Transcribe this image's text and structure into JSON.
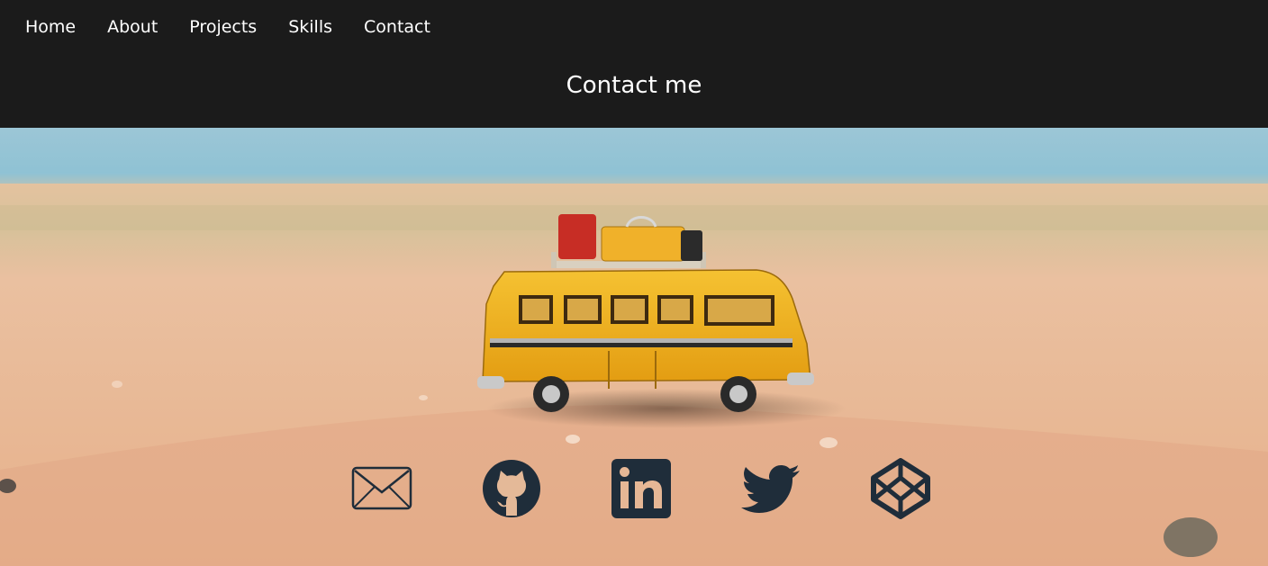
{
  "nav": {
    "items": [
      {
        "label": "Home"
      },
      {
        "label": "About"
      },
      {
        "label": "Projects"
      },
      {
        "label": "Skills"
      },
      {
        "label": "Contact"
      }
    ]
  },
  "header": {
    "title": "Contact me"
  },
  "hero": {
    "image": "toy-bus-on-beach"
  },
  "social": {
    "icons": [
      "email-icon",
      "github-icon",
      "linkedin-icon",
      "twitter-icon",
      "codepen-icon"
    ],
    "color": "#1f2d3a"
  },
  "colors": {
    "header_bg": "#1b1b1b",
    "header_text": "#ffffff",
    "sand": "#e9b58d",
    "sea": "#8ec3d6",
    "bus_yellow": "#f2b21c"
  }
}
